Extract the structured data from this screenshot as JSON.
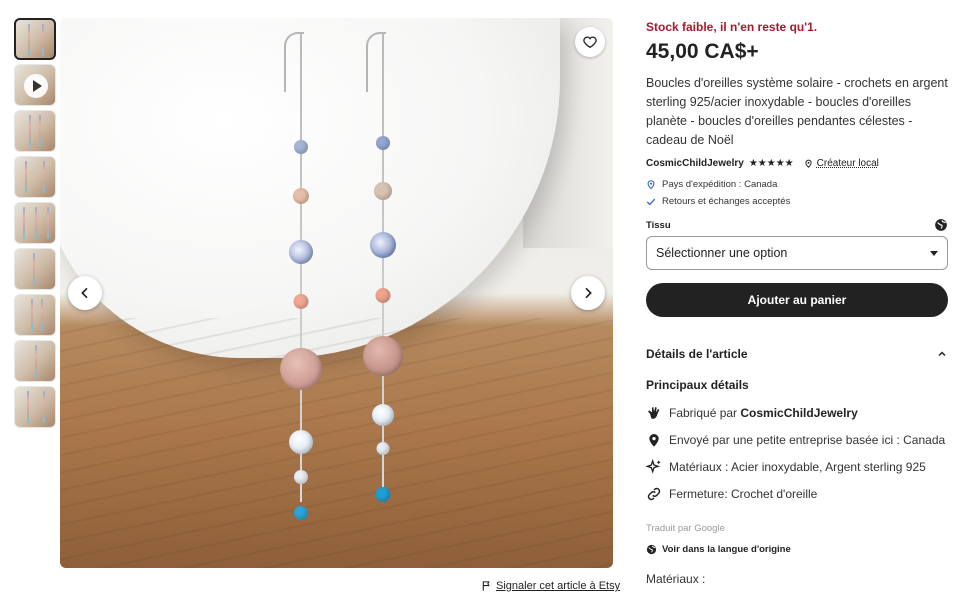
{
  "gallery": {
    "thumbnail_count": 9,
    "active_index": 0,
    "video_thumbnail_index": 1
  },
  "report": {
    "label": "Signaler cet article à Etsy"
  },
  "product": {
    "stock_notice": "Stock faible, il n'en reste qu'1.",
    "price": "45,00 CA$+",
    "title": "Boucles d'oreilles système solaire - crochets en argent sterling 925/acier inoxydable - boucles d'oreilles planète - boucles d'oreilles pendantes célestes - cadeau de Noël",
    "seller": "CosmicChildJewelry",
    "rating_stars": 5,
    "stars_text": "★★★★★",
    "local_label": "Créateur local",
    "shipping_country": "Pays d'expédition : Canada",
    "returns": "Retours et échanges acceptés"
  },
  "variation": {
    "label": "Tissu",
    "select_value": "Sélectionner une option"
  },
  "cart": {
    "label": "Ajouter au panier"
  },
  "details": {
    "section_title": "Détails de l'article",
    "sub_title": "Principaux détails",
    "made_by_prefix": "Fabriqué par ",
    "made_by_name": "CosmicChildJewelry",
    "shipped_by": "Envoyé par une petite entreprise basée ici : Canada",
    "materials": "Matériaux : Acier inoxydable, Argent sterling 925",
    "closure": "Fermeture: Crochet d'oreille",
    "translated_by": "Traduit par Google",
    "view_original": "Voir dans la langue d'origine",
    "materials_label": "Matériaux :"
  },
  "colors": {
    "stock_red": "#a61a2e",
    "button_dark": "#222222",
    "accent_blue": "#2f5fc4"
  },
  "icons": [
    "heart-icon",
    "chevron-left-icon",
    "chevron-right-icon",
    "flag-icon",
    "location-pin-icon",
    "check-icon",
    "globe-icon",
    "hand-icon",
    "sparkle-icon",
    "link-icon",
    "chevron-up-icon",
    "play-icon"
  ]
}
